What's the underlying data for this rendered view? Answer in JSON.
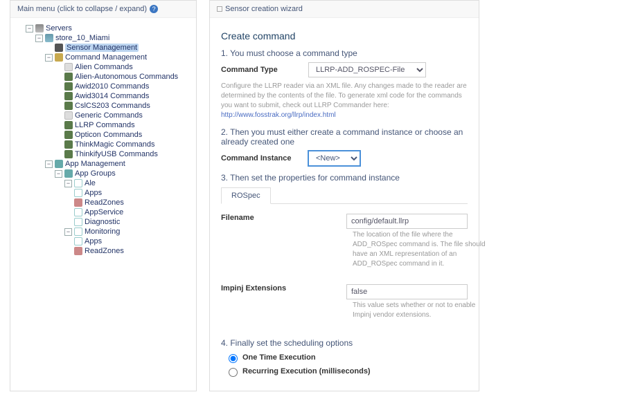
{
  "sidebar": {
    "title": "Main menu (click to collapse / expand)",
    "tree": [
      {
        "label": "Servers"
      },
      {
        "label": "store_10_Miami"
      },
      {
        "label": "Sensor Management"
      },
      {
        "label": "Command Management"
      },
      {
        "label": "Alien Commands"
      },
      {
        "label": "Alien-Autonomous Commands"
      },
      {
        "label": "Awid2010 Commands"
      },
      {
        "label": "Awid3014 Commands"
      },
      {
        "label": "CslCS203 Commands"
      },
      {
        "label": "Generic Commands"
      },
      {
        "label": "LLRP Commands"
      },
      {
        "label": "Opticon Commands"
      },
      {
        "label": "ThinkMagic Commands"
      },
      {
        "label": "ThinkifyUSB Commands"
      },
      {
        "label": "App Management"
      },
      {
        "label": "App Groups"
      },
      {
        "label": "Ale"
      },
      {
        "label": "Apps"
      },
      {
        "label": "ReadZones"
      },
      {
        "label": "AppService"
      },
      {
        "label": "Diagnostic"
      },
      {
        "label": "Monitoring"
      },
      {
        "label": "Apps"
      },
      {
        "label": "ReadZones"
      }
    ]
  },
  "main": {
    "header": "Sensor creation wizard",
    "title": "Create command",
    "step1": {
      "heading": "1. You must choose a command type",
      "label": "Command Type",
      "option": "LLRP-ADD_ROSPEC-File",
      "hint_a": "Configure the LLRP reader via an XML file. Any changes made to the reader are determined by the contents of the file. To generate xml code for the commands you want to submit, check out LLRP Commander here: ",
      "hint_link": "http://www.fosstrak.org/llrp/index.html"
    },
    "step2": {
      "heading": "2. Then you must either create a command instance or choose an already created one",
      "label": "Command Instance",
      "option": "<New>"
    },
    "step3": {
      "heading": "3. Then set the properties for command instance",
      "tab": "ROSpec",
      "filename": {
        "label": "Filename",
        "value": "config/default.llrp",
        "hint": "The location of the file where the ADD_ROSpec command is. The file should have an XML representation of an ADD_ROSpec command in it."
      },
      "impinj": {
        "label": "Impinj Extensions",
        "value": "false",
        "hint": "This value sets whether or not to enable Impinj vendor extensions."
      }
    },
    "step4": {
      "heading": "4. Finally set the scheduling options",
      "opt1": "One Time Execution",
      "opt2": "Recurring Execution (milliseconds)"
    }
  }
}
